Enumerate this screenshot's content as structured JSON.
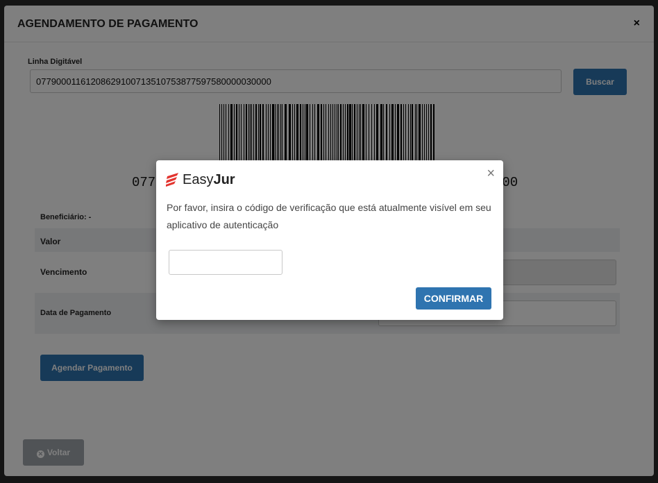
{
  "modal": {
    "title": "AGENDAMENTO DE PAGAMENTO",
    "close_label": "×"
  },
  "form": {
    "linha_label": "Linha Digitável",
    "linha_value": "07790001161208629100713510753877597580000030000",
    "buscar_label": "Buscar",
    "barcode_text_left": "077",
    "barcode_text_right": "000",
    "beneficiario_label": "Beneficiário: -",
    "valor_label": "Valor",
    "vencimento_label": "Vencimento",
    "data_pagamento_label": "Data de Pagamento",
    "agendar_label": "Agendar Pagamento",
    "voltar_label": "Voltar"
  },
  "dialog": {
    "brand_easy": "Easy",
    "brand_jur": "Jur",
    "close_label": "×",
    "message": "Por favor, insira o código de verificação que está atualmente visível em seu aplicativo de autenticação",
    "code_placeholder": "",
    "confirm_label": "CONFIRMAR"
  },
  "colors": {
    "primary": "#2f74b0",
    "secondary": "#a0a6ad",
    "brand_red": "#e3342f",
    "row_alt": "#eef1f2"
  },
  "icons": {
    "close": "close-icon",
    "voltar": "times-circle-icon",
    "logo": "easyjur-logo-icon"
  }
}
